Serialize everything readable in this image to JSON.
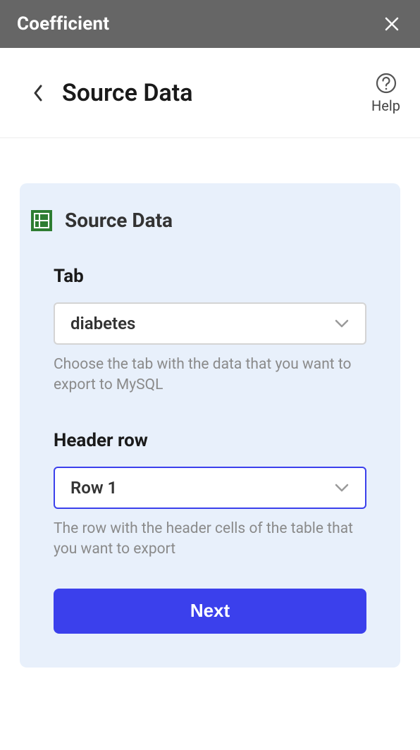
{
  "titlebar": {
    "title": "Coefficient"
  },
  "header": {
    "title": "Source Data",
    "help_label": "Help"
  },
  "card": {
    "title": "Source Data",
    "tab_field": {
      "label": "Tab",
      "value": "diabetes",
      "help": "Choose the tab with the data that you want to export to MySQL"
    },
    "header_row_field": {
      "label": "Header row",
      "value": "Row 1",
      "help": "The row with the header cells of the table that you want to export"
    },
    "next_button": "Next"
  }
}
